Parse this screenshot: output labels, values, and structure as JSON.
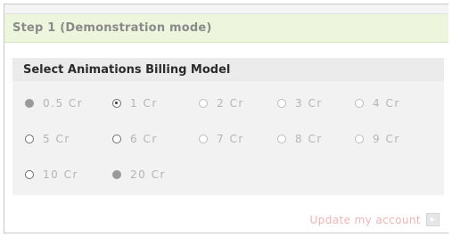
{
  "step": {
    "title": "Step 1 (Demonstration mode)"
  },
  "billing": {
    "title": "Select Animations Billing Model",
    "options": [
      {
        "label": "0.5 Cr",
        "state": "filled"
      },
      {
        "label": "1 Cr",
        "state": "checked"
      },
      {
        "label": "2 Cr",
        "state": "empty"
      },
      {
        "label": "3 Cr",
        "state": "empty"
      },
      {
        "label": "4 Cr",
        "state": "empty"
      },
      {
        "label": "5 Cr",
        "state": "dark"
      },
      {
        "label": "6 Cr",
        "state": "dark"
      },
      {
        "label": "7 Cr",
        "state": "empty"
      },
      {
        "label": "8 Cr",
        "state": "empty"
      },
      {
        "label": "9 Cr",
        "state": "empty"
      },
      {
        "label": "10 Cr",
        "state": "dark"
      },
      {
        "label": "20 Cr",
        "state": "filled"
      }
    ]
  },
  "actions": {
    "update_label": "Update my account",
    "update_icon": "arrow-right-icon"
  },
  "colors": {
    "header_bg": "#eef5dd",
    "link": "#f0b4b4"
  }
}
